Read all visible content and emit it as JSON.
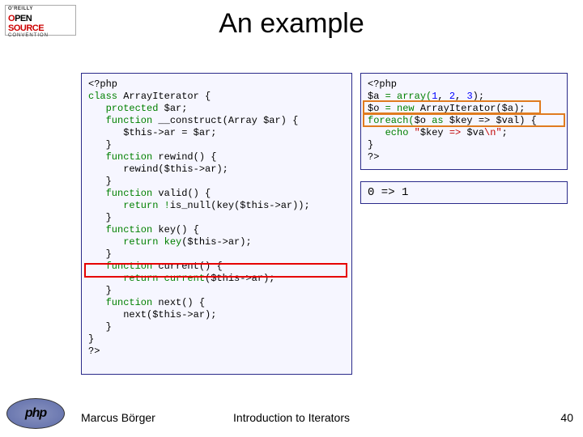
{
  "logo": {
    "oreilly": "O'REILLY",
    "open_o": "O",
    "open_pen": "PEN",
    "source": "SOURCE",
    "convention": "CONVENTION"
  },
  "title": "An example",
  "code_left": {
    "l1a": "<?php",
    "l2a": "class ",
    "l2b": "ArrayIterator ",
    "l2c": "{",
    "l3a": "   protected ",
    "l3b": "$ar",
    "l3c": ";",
    "l4a": "   function ",
    "l4b": "__construct",
    "l4c": "(Array ",
    "l4d": "$ar",
    "l4e": ") {",
    "l5a": "      $this",
    "l5b": "->",
    "l5c": "ar ",
    "l5d": "= ",
    "l5e": "$ar",
    "l5f": ";",
    "l6": "   }",
    "l7a": "   function ",
    "l7b": "rewind",
    "l7c": "() {",
    "l8a": "      rewind",
    "l8b": "(",
    "l8c": "$this",
    "l8d": "->",
    "l8e": "ar",
    "l8f": ");",
    "l9": "   }",
    "l10a": "   function ",
    "l10b": "valid",
    "l10c": "() {",
    "l11a": "      return !",
    "l11b": "is_null",
    "l11c": "(",
    "l11d": "key",
    "l11e": "(",
    "l11f": "$this",
    "l11g": "->",
    "l11h": "ar",
    "l11i": "));",
    "l12": "   }",
    "l13a": "   function ",
    "l13b": "key",
    "l13c": "() {",
    "l14a": "      return key",
    "l14b": "(",
    "l14c": "$this",
    "l14d": "->",
    "l14e": "ar",
    "l14f": ");",
    "l15": "   }",
    "l16a": "   function ",
    "l16b": "current",
    "l16c": "() {",
    "l17a": "      return current",
    "l17b": "(",
    "l17c": "$this",
    "l17d": "->",
    "l17e": "ar",
    "l17f": ");",
    "l18": "   }",
    "l19a": "   function ",
    "l19b": "next",
    "l19c": "() {",
    "l20a": "      next",
    "l20b": "(",
    "l20c": "$this",
    "l20d": "->",
    "l20e": "ar",
    "l20f": ");",
    "l21": "   }",
    "l22": "}",
    "l23": "?>"
  },
  "code_right": {
    "r1": "<?php",
    "r2a": "$a ",
    "r2b": "= array(",
    "r2c": "1",
    "r2d": ", ",
    "r2e": "2",
    "r2f": ", ",
    "r2g": "3",
    "r2h": ");",
    "r3a": "$o ",
    "r3b": "= new ",
    "r3c": "ArrayIterator",
    "r3d": "(",
    "r3e": "$a",
    "r3f": ");",
    "r4a": "foreach(",
    "r4b": "$o ",
    "r4c": "as ",
    "r4d": "$key ",
    "r4e": "=> ",
    "r4f": "$val",
    "r4g": ") {",
    "r5a": "   echo ",
    "r5b": "\"",
    "r5c": "$key",
    "r5d": " => ",
    "r5e": "$va",
    "r5f": "\\n\"",
    "r5g": ";",
    "r6": "}",
    "r7": "?>"
  },
  "output": "0 => 1",
  "footer": {
    "php": "php",
    "author": "Marcus Börger",
    "presentation": "Introduction to Iterators",
    "page": "40"
  }
}
